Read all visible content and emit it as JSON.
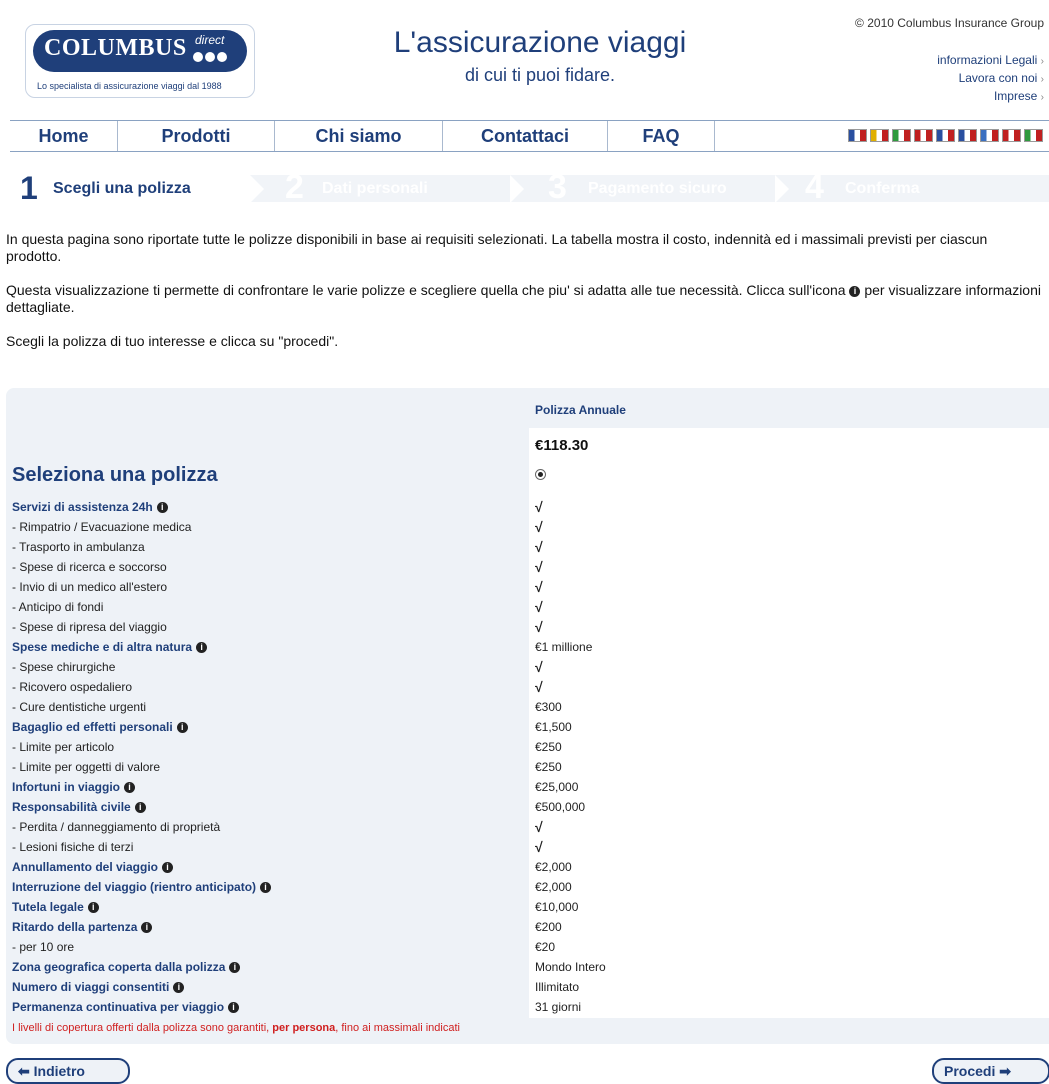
{
  "header": {
    "logo_text": "COLUMBUS",
    "logo_sub": "direct",
    "logo_tagline": "Lo specialista di assicurazione viaggi dal 1988",
    "title": "L'assicurazione viaggi",
    "subtitle": "di cui ti puoi fidare.",
    "copyright": "© 2010 Columbus Insurance Group",
    "links": [
      "informazioni Legali",
      "Lavora con noi",
      "Imprese"
    ]
  },
  "nav": {
    "items": [
      "Home",
      "Prodotti",
      "Chi siamo",
      "Contattaci",
      "FAQ"
    ],
    "flags": [
      {
        "name": "uk-flag-icon",
        "color": "#2a4fa0"
      },
      {
        "name": "spain-flag-icon",
        "color": "#e0b000"
      },
      {
        "name": "italy-flag-icon",
        "color": "#2e9a3d"
      },
      {
        "name": "germany-flag-icon",
        "color": "#c02020"
      },
      {
        "name": "france-flag-icon",
        "color": "#2a4fa0"
      },
      {
        "name": "nordic-flag-icon",
        "color": "#2a4fa0"
      },
      {
        "name": "greece-flag-icon",
        "color": "#3a6fc0"
      },
      {
        "name": "netherlands-flag-icon",
        "color": "#c02020"
      },
      {
        "name": "ireland-flag-icon",
        "color": "#2e9a3d"
      }
    ]
  },
  "steps": [
    {
      "num": "1",
      "label": "Scegli una polizza"
    },
    {
      "num": "2",
      "label": "Dati personali"
    },
    {
      "num": "3",
      "label": "Pagamento sicuro"
    },
    {
      "num": "4",
      "label": "Conferma"
    }
  ],
  "intro": {
    "p1": "In questa pagina sono riportate tutte le polizze disponibili in base ai requisiti selezionati. La tabella mostra il costo, indennità ed i massimali previsti per ciascun prodotto.",
    "p2a": "Questa visualizzazione ti permette di confrontare le varie polizze e scegliere quella che piu' si adatta alle tue necessità. Clicca sull'icona",
    "p2b": "per visualizzare informazioni dettagliate.",
    "p3": "Scegli la polizza di tuo interesse e clicca su \"procedi\"."
  },
  "table": {
    "column_header": "Polizza Annuale",
    "price": "€118.30",
    "select_title": "Seleziona una polizza",
    "rows": [
      {
        "label": "Servizi di assistenza 24h",
        "bold": true,
        "info": true,
        "value": "√",
        "tick": true
      },
      {
        "label": "- Rimpatrio / Evacuazione medica",
        "value": "√",
        "tick": true
      },
      {
        "label": "- Trasporto in ambulanza",
        "value": "√",
        "tick": true
      },
      {
        "label": "- Spese di ricerca e soccorso",
        "value": "√",
        "tick": true
      },
      {
        "label": "- Invio di un medico all'estero",
        "value": "√",
        "tick": true
      },
      {
        "label": "- Anticipo di fondi",
        "value": "√",
        "tick": true
      },
      {
        "label": "- Spese di ripresa del viaggio",
        "value": "√",
        "tick": true
      },
      {
        "label": "Spese mediche e di altra natura",
        "bold": true,
        "info": true,
        "value": "€1 millione"
      },
      {
        "label": "- Spese chirurgiche",
        "value": "√",
        "tick": true
      },
      {
        "label": "- Ricovero ospedaliero",
        "value": "√",
        "tick": true
      },
      {
        "label": "- Cure dentistiche urgenti",
        "value": "€300"
      },
      {
        "label": "Bagaglio ed effetti personali",
        "bold": true,
        "info": true,
        "value": "€1,500"
      },
      {
        "label": "- Limite per articolo",
        "value": "€250"
      },
      {
        "label": "- Limite per oggetti di valore",
        "value": "€250"
      },
      {
        "label": "Infortuni in viaggio",
        "bold": true,
        "info": true,
        "value": "€25,000"
      },
      {
        "label": "Responsabilità civile",
        "bold": true,
        "info": true,
        "value": "€500,000"
      },
      {
        "label": "- Perdita / danneggiamento di proprietà",
        "value": "√",
        "tick": true
      },
      {
        "label": "- Lesioni fisiche di terzi",
        "value": "√",
        "tick": true
      },
      {
        "label": "Annullamento del viaggio",
        "bold": true,
        "info": true,
        "value": "€2,000"
      },
      {
        "label": "Interruzione del viaggio (rientro anticipato)",
        "bold": true,
        "info": true,
        "value": "€2,000"
      },
      {
        "label": "Tutela legale",
        "bold": true,
        "info": true,
        "value": "€10,000"
      },
      {
        "label": "Ritardo della partenza",
        "bold": true,
        "info": true,
        "value": "€200"
      },
      {
        "label": "- per 10 ore",
        "value": "€20"
      },
      {
        "label": "Zona geografica coperta dalla polizza",
        "bold": true,
        "info": true,
        "value": "Mondo Intero"
      },
      {
        "label": "Numero di viaggi consentiti",
        "bold": true,
        "info": true,
        "value": "Illimitato"
      },
      {
        "label": "Permanenza continuativa per viaggio",
        "bold": true,
        "info": true,
        "value": "31 giorni"
      }
    ],
    "footnote_a": "I livelli di copertura offerti dalla polizza sono garantiti, ",
    "footnote_b": "per persona",
    "footnote_c": ", fino ai massimali indicati"
  },
  "buttons": {
    "back": "Indietro",
    "next": "Procedi"
  },
  "colors": {
    "brand": "#1f3f7a",
    "tick": "#2c9a2c",
    "note": "#d02020"
  }
}
